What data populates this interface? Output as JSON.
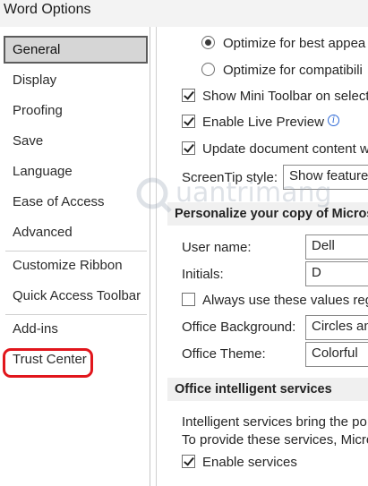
{
  "window": {
    "title": "Word Options"
  },
  "sidebar": {
    "items": [
      {
        "label": "General",
        "selected": true
      },
      {
        "label": "Display"
      },
      {
        "label": "Proofing"
      },
      {
        "label": "Save"
      },
      {
        "label": "Language"
      },
      {
        "label": "Ease of Access"
      },
      {
        "label": "Advanced"
      },
      {
        "label": "Customize Ribbon"
      },
      {
        "label": "Quick Access Toolbar"
      },
      {
        "label": "Add-ins"
      },
      {
        "label": "Trust Center",
        "highlighted": true
      }
    ]
  },
  "general": {
    "ui_options": {
      "optimize_best": "Optimize for best appea",
      "optimize_compat": "Optimize for compatibili",
      "mini_toolbar": "Show Mini Toolbar on select",
      "live_preview": "Enable Live Preview",
      "update_content": "Update document content w",
      "screentip_label": "ScreenTip style:",
      "screentip_value": "Show feature"
    },
    "personalize": {
      "header": "Personalize your copy of Micros",
      "username_label": "User name:",
      "username_value": "Dell",
      "initials_label": "Initials:",
      "initials_value": "D",
      "always_use": "Always use these values rega",
      "background_label": "Office Background:",
      "background_value": "Circles an",
      "theme_label": "Office Theme:",
      "theme_value": "Colorful"
    },
    "intelligent": {
      "header": "Office intelligent services",
      "desc1": "Intelligent services bring the po",
      "desc2": "To provide these services, Micro",
      "enable": "Enable services"
    }
  },
  "watermark": {
    "text": "uantrimang"
  },
  "colors": {
    "highlight": "#e1161c",
    "selected_bg": "#d6d6d6"
  },
  "icons": [
    "info-icon",
    "radio-selected",
    "checkbox-checked"
  ]
}
